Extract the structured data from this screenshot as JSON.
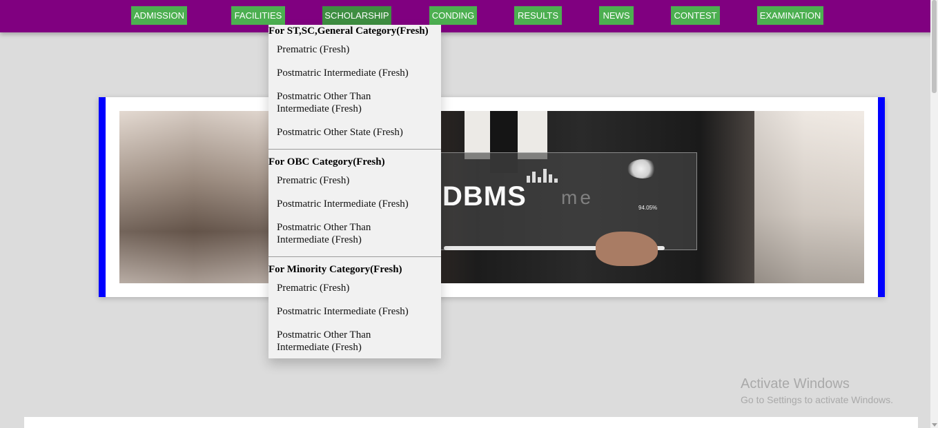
{
  "nav": {
    "items": [
      {
        "label": "ADMISSION"
      },
      {
        "label": "FACILITIES"
      },
      {
        "label": "SCHOLARSHIP"
      },
      {
        "label": "CONDING"
      },
      {
        "label": "RESULTS"
      },
      {
        "label": "NEWS"
      },
      {
        "label": "CONTEST"
      },
      {
        "label": "EXAMINATION"
      }
    ],
    "active": "SCHOLARSHIP"
  },
  "dropdown": {
    "sections": [
      {
        "heading": "For ST,SC,General Category(Fresh)",
        "items": [
          "Prematric (Fresh)",
          "Postmatric Intermediate (Fresh)",
          "Postmatric Other Than Intermediate (Fresh)",
          "Postmatric Other State (Fresh)"
        ]
      },
      {
        "heading": "For OBC Category(Fresh)",
        "items": [
          "Prematric (Fresh)",
          "Postmatric Intermediate (Fresh)",
          "Postmatric Other Than Intermediate (Fresh)"
        ]
      },
      {
        "heading": "For Minority Category(Fresh)",
        "items": [
          "Prematric (Fresh)",
          "Postmatric Intermediate (Fresh)",
          "Postmatric Other Than Intermediate (Fresh)"
        ]
      }
    ]
  },
  "banner": {
    "screen_text": "DBMS",
    "ghost_text": "me",
    "percent_text": "94.05%"
  },
  "watermark": {
    "title": "Activate Windows",
    "subtitle": "Go to Settings to activate Windows."
  },
  "colors": {
    "nav_bg": "#800080",
    "nav_button": "#4caf50",
    "banner_edge": "#0000ff",
    "page_bg": "#dcdcdc",
    "dropdown_bg": "#f1f1f1"
  }
}
